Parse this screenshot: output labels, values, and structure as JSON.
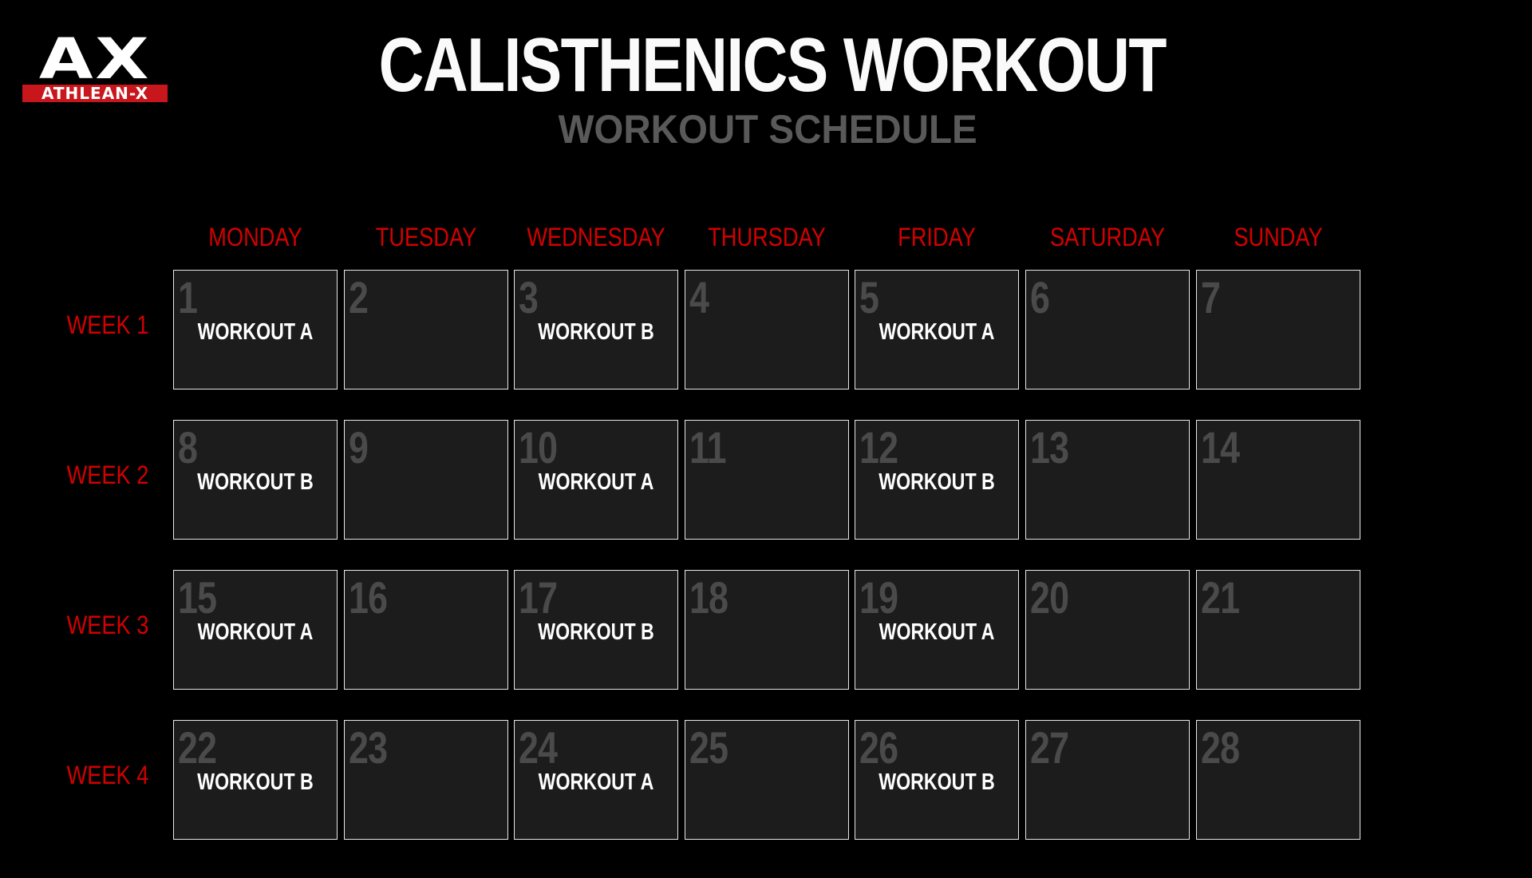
{
  "brand": {
    "logo_mark": "AX",
    "logo_text": "ATHLEAN-X",
    "accent_color": "#c8161d"
  },
  "header": {
    "title": "CALISTHENICS WORKOUT",
    "subtitle": "WORKOUT SCHEDULE"
  },
  "days": [
    "MONDAY",
    "TUESDAY",
    "WEDNESDAY",
    "THURSDAY",
    "FRIDAY",
    "SATURDAY",
    "SUNDAY"
  ],
  "weeks": [
    {
      "label": "WEEK 1",
      "cells": [
        {
          "day": "1",
          "workout": "WORKOUT A"
        },
        {
          "day": "2",
          "workout": ""
        },
        {
          "day": "3",
          "workout": "WORKOUT B"
        },
        {
          "day": "4",
          "workout": ""
        },
        {
          "day": "5",
          "workout": "WORKOUT A"
        },
        {
          "day": "6",
          "workout": ""
        },
        {
          "day": "7",
          "workout": ""
        }
      ]
    },
    {
      "label": "WEEK 2",
      "cells": [
        {
          "day": "8",
          "workout": "WORKOUT B"
        },
        {
          "day": "9",
          "workout": ""
        },
        {
          "day": "10",
          "workout": "WORKOUT A"
        },
        {
          "day": "11",
          "workout": ""
        },
        {
          "day": "12",
          "workout": "WORKOUT B"
        },
        {
          "day": "13",
          "workout": ""
        },
        {
          "day": "14",
          "workout": ""
        }
      ]
    },
    {
      "label": "WEEK 3",
      "cells": [
        {
          "day": "15",
          "workout": "WORKOUT A"
        },
        {
          "day": "16",
          "workout": ""
        },
        {
          "day": "17",
          "workout": "WORKOUT B"
        },
        {
          "day": "18",
          "workout": ""
        },
        {
          "day": "19",
          "workout": "WORKOUT A"
        },
        {
          "day": "20",
          "workout": ""
        },
        {
          "day": "21",
          "workout": ""
        }
      ]
    },
    {
      "label": "WEEK 4",
      "cells": [
        {
          "day": "22",
          "workout": "WORKOUT B"
        },
        {
          "day": "23",
          "workout": ""
        },
        {
          "day": "24",
          "workout": "WORKOUT A"
        },
        {
          "day": "25",
          "workout": ""
        },
        {
          "day": "26",
          "workout": "WORKOUT B"
        },
        {
          "day": "27",
          "workout": ""
        },
        {
          "day": "28",
          "workout": ""
        }
      ]
    }
  ]
}
